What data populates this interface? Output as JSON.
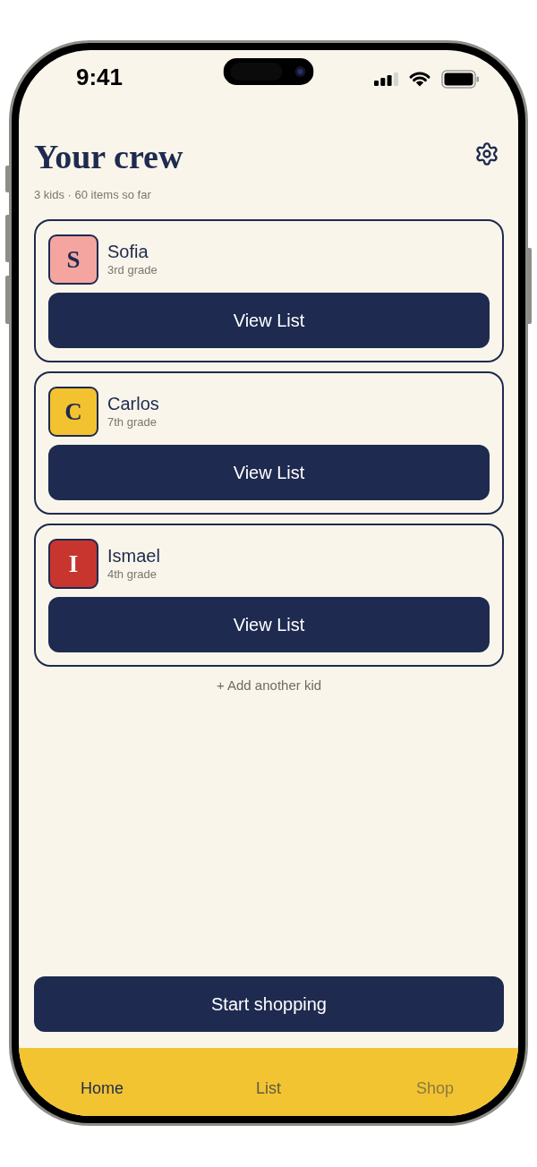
{
  "status_bar": {
    "time": "9:41"
  },
  "header": {
    "title": "Your crew",
    "subtitle": "3 kids · 60 items so far"
  },
  "kids": [
    {
      "initial": "S",
      "name": "Sofia",
      "grade": "3rd grade",
      "color": "#f4a5a0",
      "button": "View List"
    },
    {
      "initial": "C",
      "name": "Carlos",
      "grade": "7th grade",
      "color": "#f2c230",
      "button": "View List"
    },
    {
      "initial": "I",
      "name": "Ismael",
      "grade": "4th grade",
      "color": "#c8352e",
      "button": "View List"
    }
  ],
  "add_kid": "+ Add another kid",
  "primary_button": "Start shopping",
  "tabs": [
    {
      "label": "Home",
      "selected": true,
      "disabled": false
    },
    {
      "label": "List",
      "selected": false,
      "disabled": false
    },
    {
      "label": "Shop",
      "selected": false,
      "disabled": true
    }
  ]
}
